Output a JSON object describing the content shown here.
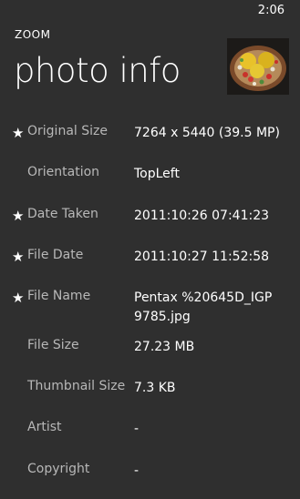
{
  "status_bar": {
    "time": "2:06"
  },
  "header": {
    "app_name": "ZOOM",
    "page_title": "photo info",
    "thumbnail_icon": "photo-thumbnail"
  },
  "fields": [
    {
      "starred": true,
      "label": "Original Size",
      "value": "7264 x 5440 (39.5 MP)"
    },
    {
      "starred": false,
      "label": "Orientation",
      "value": "TopLeft"
    },
    {
      "starred": true,
      "label": "Date Taken",
      "value": "2011:10:26 07:41:23"
    },
    {
      "starred": true,
      "label": "File Date",
      "value": "2011:10:27 11:52:58"
    },
    {
      "starred": true,
      "label": "File Name",
      "value": "Pentax %20645D_IGP9785.jpg"
    },
    {
      "starred": false,
      "label": "File Size",
      "value": "27.23 MB"
    },
    {
      "starred": false,
      "label": "Thumbnail Size",
      "value": "7.3 KB"
    },
    {
      "starred": false,
      "label": "Artist",
      "value": "-"
    },
    {
      "starred": false,
      "label": "Copyright",
      "value": "-"
    }
  ],
  "star_glyph": "★",
  "colors": {
    "background": "#2f2f2f",
    "label": "#b8b8b8",
    "value": "#ffffff"
  }
}
